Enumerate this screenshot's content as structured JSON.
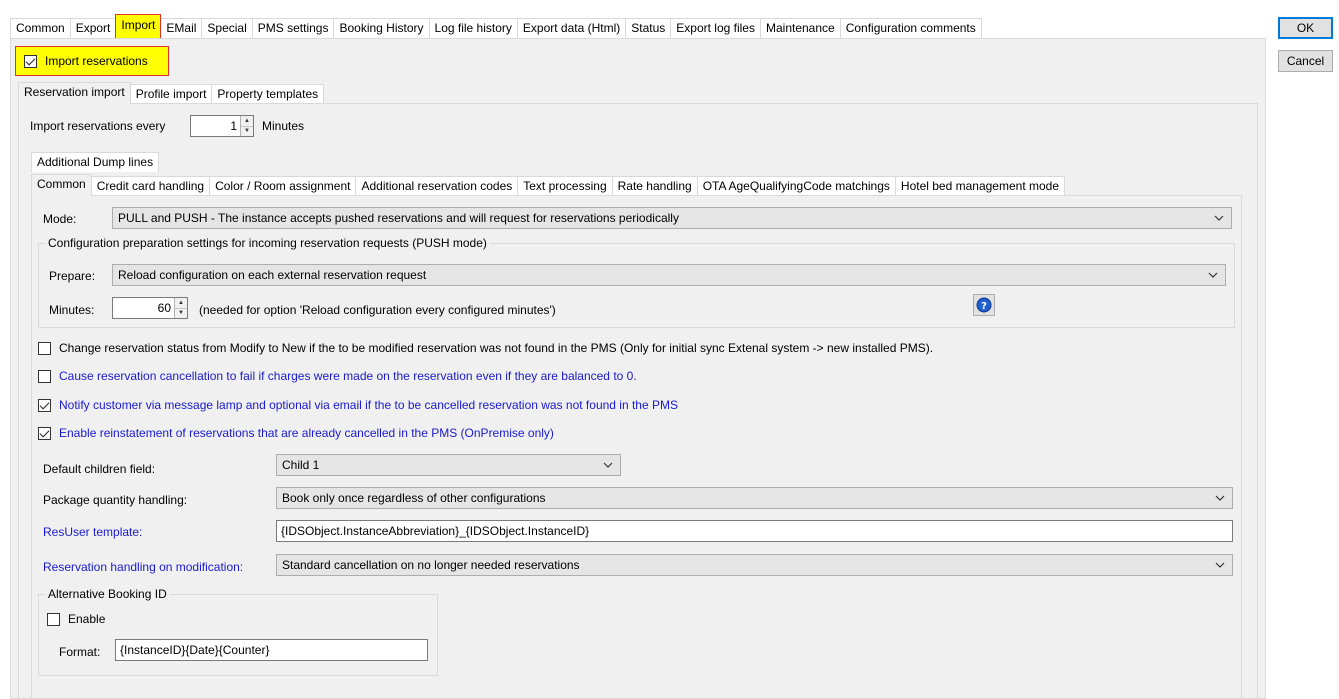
{
  "top_tabs": [
    "Common",
    "Export",
    "Import",
    "EMail",
    "Special",
    "PMS settings",
    "Booking History",
    "Log file history",
    "Export data (Html)",
    "Status",
    "Export log files",
    "Maintenance",
    "Configuration comments"
  ],
  "buttons": {
    "ok": "OK",
    "cancel": "Cancel"
  },
  "import_reservations": {
    "label": "Import reservations",
    "checked": true
  },
  "sub_tabs": [
    "Reservation import",
    "Profile import",
    "Property templates"
  ],
  "interval": {
    "label": "Import reservations every",
    "value": "1",
    "unit": "Minutes"
  },
  "inner_tabs_row1": [
    "Additional Dump lines"
  ],
  "inner_tabs_row2": [
    "Common",
    "Credit card handling",
    "Color / Room assignment",
    "Additional reservation codes",
    "Text processing",
    "Rate handling",
    "OTA AgeQualifyingCode matchings",
    "Hotel bed management mode"
  ],
  "mode": {
    "label": "Mode:",
    "value": "PULL and PUSH - The instance accepts pushed reservations and will request for reservations periodically"
  },
  "config_group": {
    "title": "Configuration preparation settings for incoming reservation requests (PUSH mode)",
    "prepare_label": "Prepare:",
    "prepare_value": "Reload configuration on each external reservation request",
    "minutes_label": "Minutes:",
    "minutes_value": "60",
    "minutes_note": "(needed for option 'Reload configuration every configured minutes')",
    "help_icon": "help-icon"
  },
  "checkboxes": [
    {
      "label": "Change reservation status from Modify to New if the to be modified reservation was not found in the PMS (Only for initial sync Extenal system -> new installed PMS).",
      "checked": false,
      "color": "black"
    },
    {
      "label": "Cause reservation cancellation to fail if charges were made on the reservation even if they are balanced to 0.",
      "checked": false,
      "color": "blue"
    },
    {
      "label": "Notify customer via message lamp and optional via email if the to be cancelled reservation was not found in the PMS",
      "checked": true,
      "color": "blue"
    },
    {
      "label": "Enable reinstatement of reservations that are already cancelled in the PMS (OnPremise only)",
      "checked": true,
      "color": "blue"
    }
  ],
  "fields": {
    "children_label": "Default children field:",
    "children_value": "Child 1",
    "package_label": "Package quantity handling:",
    "package_value": "Book only once regardless of other configurations",
    "resuser_label": "ResUser template:",
    "resuser_value": "{IDSObject.InstanceAbbreviation}_{IDSObject.InstanceID}",
    "modification_label": "Reservation handling on modification:",
    "modification_value": "Standard cancellation on no longer needed reservations"
  },
  "alt_booking": {
    "title": "Alternative Booking ID",
    "enable_label": "Enable",
    "enable_checked": false,
    "format_label": "Format:",
    "format_value": "{InstanceID}{Date}{Counter}"
  },
  "colors": {
    "highlight": "#ffff00",
    "highlight_border": "#e03030",
    "link_blue": "#1a1ad0",
    "panel_bg": "#f0f0f0"
  }
}
